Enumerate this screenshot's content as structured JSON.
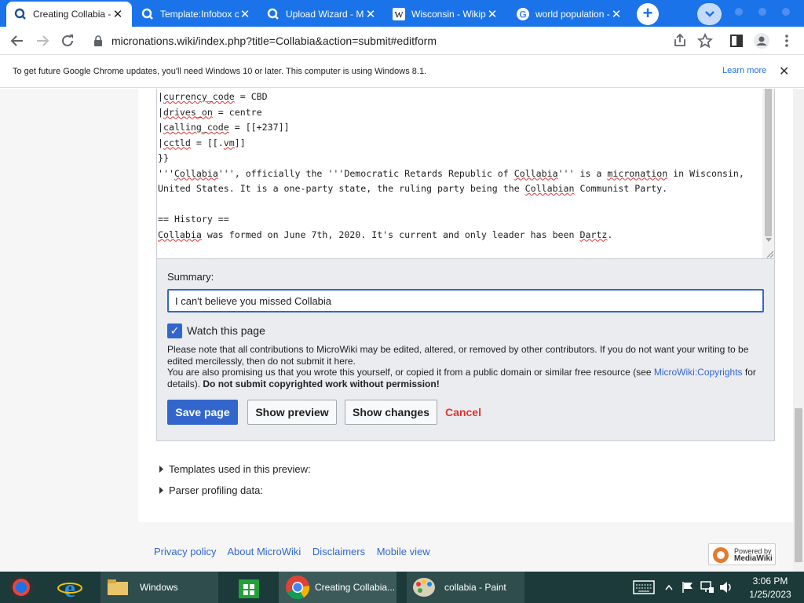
{
  "browser": {
    "tabs": [
      {
        "title": "Creating Collabia - M",
        "favicon": "wiki-icon",
        "active": true
      },
      {
        "title": "Template:Infobox co",
        "favicon": "wiki-icon",
        "active": false
      },
      {
        "title": "Upload Wizard - Mic",
        "favicon": "wiki-icon",
        "active": false
      },
      {
        "title": "Wisconsin - Wikiped",
        "favicon": "wikipedia-icon",
        "active": false
      },
      {
        "title": "world population - G",
        "favicon": "google-icon",
        "active": false
      }
    ],
    "new_tab": "+",
    "url": "micronations.wiki/index.php?title=Collabia&action=submit#editform"
  },
  "infobar": {
    "message": "To get future Google Chrome updates, you'll need Windows 10 or later. This computer is using Windows 8.1.",
    "learn_more": "Learn more",
    "close": "✕"
  },
  "editor": {
    "lines": [
      {
        "pipe": "|",
        "key": "currency_code",
        "sep": " = ",
        "value": "CBD"
      },
      {
        "pipe": "|",
        "key": "drives_on",
        "sep": " = ",
        "value": "centre"
      },
      {
        "pipe": "|",
        "key": "calling_code",
        "sep": " = ",
        "value": "[[+237]]"
      },
      {
        "pipe": "|",
        "key": "cctld",
        "sep": " = [[.",
        "value": "vm",
        "tail": "]]"
      }
    ],
    "close_braces": "}}",
    "para1_a": "'''",
    "para1_b": "Collabia",
    "para1_c": "''', officially the '''Democratic Retards Republic of ",
    "para1_d": "Collabia",
    "para1_e": "''' is a ",
    "para1_f": "micronation",
    "para1_g": " in Wisconsin,",
    "para2_a": "United States. It is a one-party state, the ruling party being the ",
    "para2_b": "Collabian",
    "para2_c": " Communist Party.",
    "heading": "== History ==",
    "para3_a": "Collabia",
    "para3_b": " was formed on June 7th, 2020. It's current and only leader has been ",
    "para3_c": "Dartz",
    "para3_d": "."
  },
  "edit_options": {
    "summary_label": "Summary:",
    "summary_value": "I can't believe you missed Collabia",
    "watch_label": "Watch this page",
    "watch_checked": true,
    "notice_1": "Please note that all contributions to MicroWiki may be edited, altered, or removed by other contributors. If you do not want your writing to be edited mercilessly, then do not submit it here.",
    "notice_2a": "You are also promising us that you wrote this yourself, or copied it from a public domain or similar free resource (see ",
    "notice_2_link": "MicroWiki:Copyrights",
    "notice_2b": " for details). ",
    "notice_2_bold": "Do not submit copyrighted work without permission!",
    "save": "Save page",
    "preview": "Show preview",
    "changes": "Show changes",
    "cancel": "Cancel"
  },
  "collapsibles": {
    "templates": "Templates used in this preview:",
    "parser": "Parser profiling data:"
  },
  "footer": {
    "links": [
      "Privacy policy",
      "About MicroWiki",
      "Disclaimers",
      "Mobile view"
    ],
    "powered_line1": "Powered by",
    "powered_line2": "MediaWiki"
  },
  "taskbar": {
    "items": [
      {
        "label": "Windows",
        "icon": "folder-icon"
      },
      {
        "label": "Creating Collabia...",
        "icon": "chrome-icon"
      },
      {
        "label": "collabia - Paint",
        "icon": "paint-icon"
      }
    ],
    "time": "3:06 PM",
    "date": "1/25/2023"
  },
  "colors": {
    "chrome_blue": "#1a73e8",
    "wiki_link": "#3366cc",
    "destructive": "#dd3333",
    "taskbar": "#1c3a3a"
  }
}
